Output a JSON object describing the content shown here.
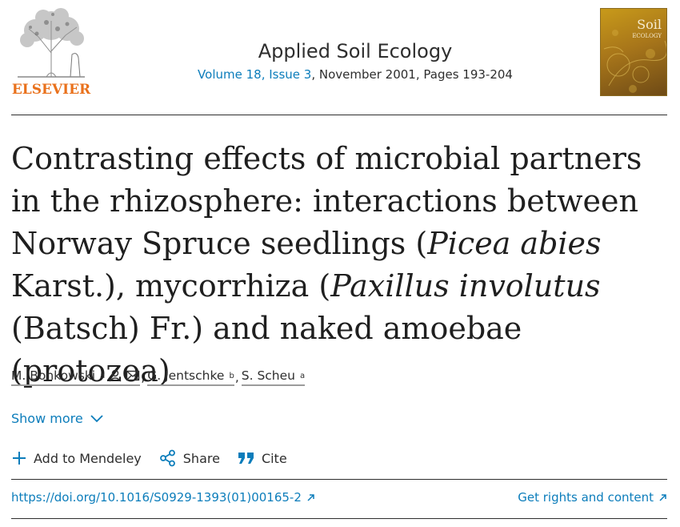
{
  "header": {
    "publisher": "ELSEVIER",
    "journal_title": "Applied Soil Ecology",
    "volume_issue": "Volume 18, Issue 3",
    "date_pages": ", November 2001, Pages 193-204",
    "cover_title_line1": "Soil",
    "cover_title_line2": "ECOLOGY"
  },
  "article": {
    "title_part1": "Contrasting effects of microbial partners in the rhizosphere: interactions between Norway Spruce seedlings (",
    "title_italic1": "Picea abies",
    "title_part2": " Karst.), mycorrhiza (",
    "title_italic2": "Paxillus involutus",
    "title_part3": " (Batsch) Fr.) and naked amoebae (protozoa)"
  },
  "authors": [
    {
      "name": "M. Bonkowski",
      "affiliation": "a"
    },
    {
      "name": "G. Jentschke",
      "affiliation": "b"
    },
    {
      "name": "S. Scheu",
      "affiliation": "a"
    }
  ],
  "show_more": "Show more",
  "actions": {
    "mendeley": "Add to Mendeley",
    "share": "Share",
    "cite": "Cite"
  },
  "links": {
    "doi": "https://doi.org/10.1016/S0929-1393(01)00165-2",
    "rights": "Get rights and content"
  },
  "colors": {
    "link": "#0c7dbb",
    "elsevier_orange": "#e9711c",
    "text": "#2e2e2e"
  }
}
